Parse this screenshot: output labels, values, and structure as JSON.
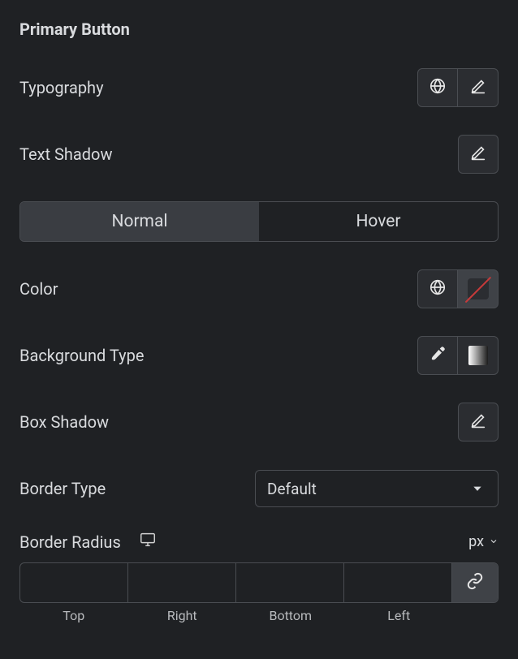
{
  "section_title": "Primary Button",
  "rows": {
    "typography": {
      "label": "Typography"
    },
    "text_shadow": {
      "label": "Text Shadow"
    },
    "color": {
      "label": "Color"
    },
    "background_type": {
      "label": "Background Type"
    },
    "box_shadow": {
      "label": "Box Shadow"
    },
    "border_type": {
      "label": "Border Type",
      "value": "Default"
    },
    "border_radius": {
      "label": "Border Radius",
      "unit": "px",
      "sides": {
        "top": "Top",
        "right": "Right",
        "bottom": "Bottom",
        "left": "Left"
      },
      "values": {
        "top": "",
        "right": "",
        "bottom": "",
        "left": ""
      },
      "linked": true
    }
  },
  "tabs": {
    "normal": "Normal",
    "hover": "Hover",
    "active": "normal"
  }
}
